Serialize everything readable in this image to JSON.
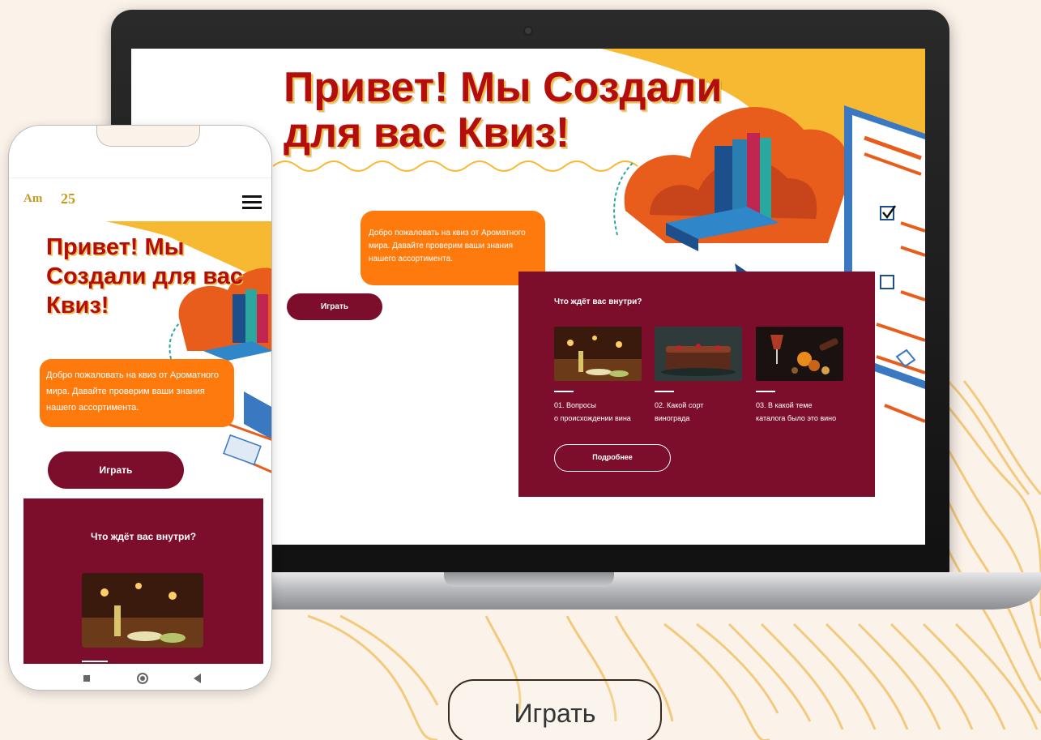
{
  "colors": {
    "background": "#fbf3ea",
    "accent_orange": "#ff7a0c",
    "wine": "#7c0e2c",
    "title_red": "#b40d0d",
    "title_shadow_yellow": "#f0c040",
    "waves": "#f2c46b"
  },
  "laptop": {
    "hero_title": "Привет! Мы Создали для вас Квиз!",
    "welcome_text": "Добро пожаловать на квиз от Ароматного мира. Давайте проверим ваши знания нашего ассортимента.",
    "play_label": "Играть",
    "card": {
      "title": "Что ждёт вас внутри?",
      "items": [
        {
          "label_line1": "01. Вопросы",
          "label_line2": "о происхождении вина",
          "image": "wine-cellar-photo"
        },
        {
          "label_line1": "02. Какой сорт",
          "label_line2": "винограда",
          "image": "cake-photo"
        },
        {
          "label_line1": "03. В какой теме",
          "label_line2": "каталога было это вино",
          "image": "wine-snacks-photo"
        }
      ],
      "more_label": "Подробнее"
    }
  },
  "phone": {
    "logo_left": "Am",
    "logo_right": "25",
    "menu_icon": "hamburger-icon",
    "hero_title": "Привет! Мы Создали для вас Квиз!",
    "welcome_text": "Добро пожаловать на квиз от Ароматного мира. Давайте проверим ваши знания нашего ассортимента.",
    "play_label": "Играть",
    "card_title": "Что ждёт вас внутри?",
    "nav_icons": [
      "square-icon",
      "home-circle-icon",
      "back-triangle-icon"
    ]
  },
  "cta": {
    "play_label": "Играть"
  }
}
